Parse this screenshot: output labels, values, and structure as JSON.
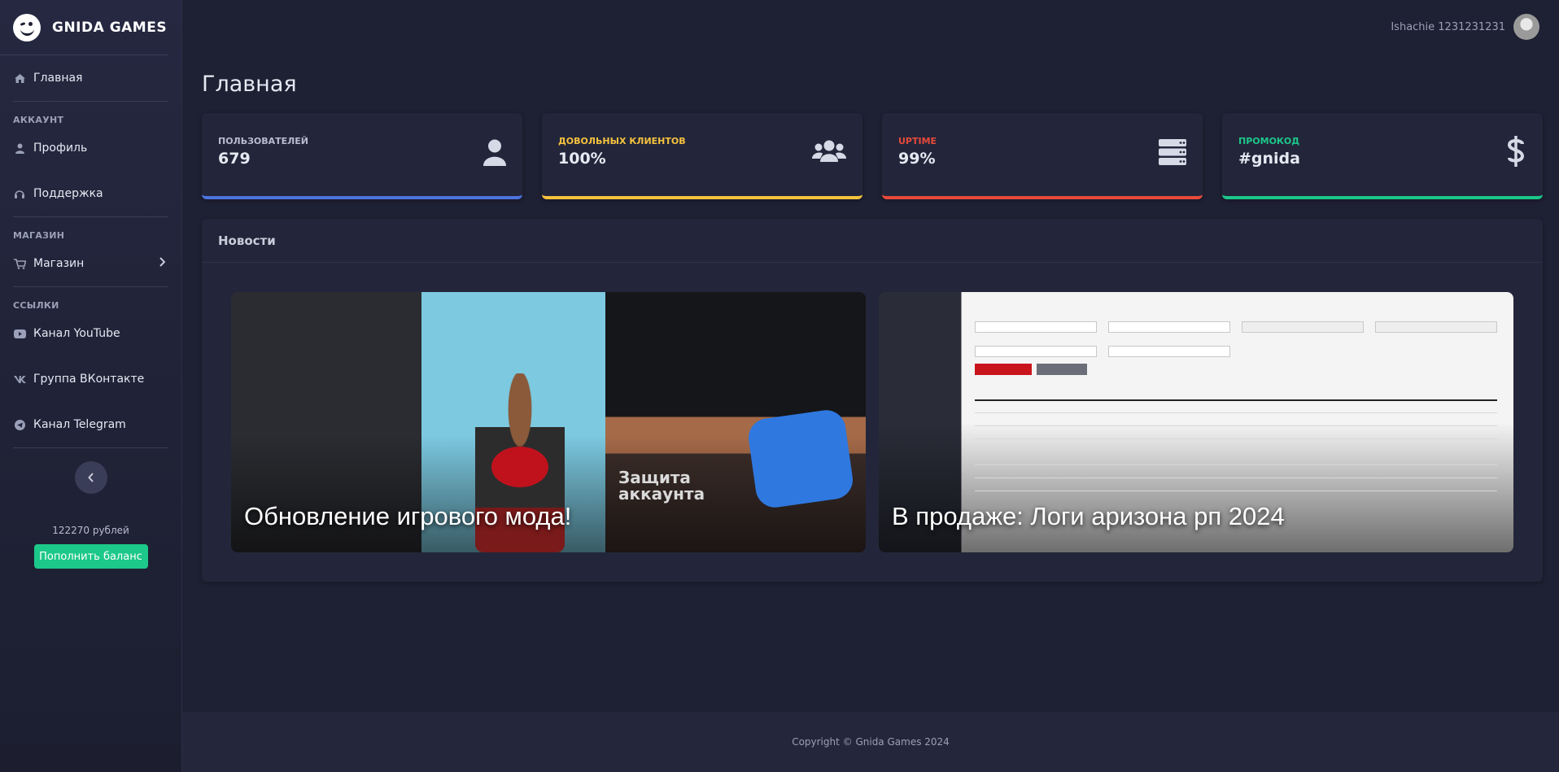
{
  "brand": {
    "name": "GNIDA GAMES"
  },
  "sidebar": {
    "items": [
      {
        "label": "Главная",
        "icon": "home-icon"
      },
      {
        "section": "АККАУНТ"
      },
      {
        "label": "Профиль",
        "icon": "user-icon"
      },
      {
        "label": "Поддержка",
        "icon": "headset-icon"
      },
      {
        "section": "МАГАЗИН"
      },
      {
        "label": "Магазин",
        "icon": "cart-icon"
      },
      {
        "section": "ССЫЛКИ"
      },
      {
        "label": "Канал YouTube",
        "icon": "youtube-icon"
      },
      {
        "label": "Группа ВКонтакте",
        "icon": "vk-icon"
      },
      {
        "label": "Канал Telegram",
        "icon": "telegram-icon"
      }
    ],
    "balance": "122270 рублей",
    "topup_label": "Пополнить баланс"
  },
  "topbar": {
    "user_name": "Ishachie 1231231231"
  },
  "page": {
    "title": "Главная"
  },
  "stats": [
    {
      "label": "ПОЛЬЗОВАТЕЛЕЙ",
      "value": "679",
      "icon": "user-icon",
      "color": "#4e73df"
    },
    {
      "label": "ДОВОЛЬНЫХ КЛИЕНТОВ",
      "value": "100%",
      "icon": "users-icon",
      "color": "#f6c23e"
    },
    {
      "label": "UPTIME",
      "value": "99%",
      "icon": "server-icon",
      "color": "#e74a3b"
    },
    {
      "label": "ПРОМОКОД",
      "value": "#gnida",
      "icon": "dollar-icon",
      "color": "#1cc88a"
    }
  ],
  "news": {
    "title": "Новости",
    "items": [
      {
        "title": "Обновление игрового мода!",
        "image_text": [
          "Защита",
          "аккаунта"
        ]
      },
      {
        "title": "В продаже: Логи аризона рп 2024"
      }
    ]
  },
  "footer": {
    "copyright": "Copyright © Gnida Games 2024"
  }
}
